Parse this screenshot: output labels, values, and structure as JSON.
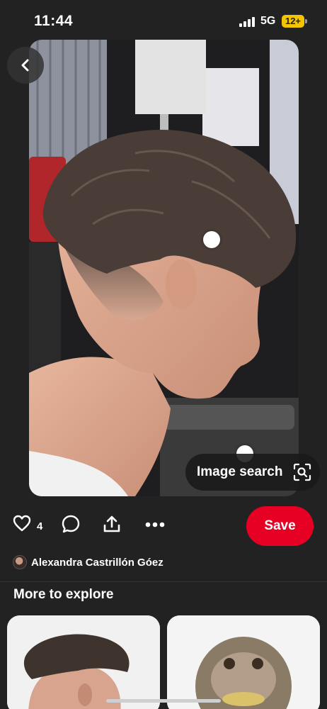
{
  "status_bar": {
    "time": "11:44",
    "network": "5G",
    "battery": "12+"
  },
  "pin": {
    "image_description_icon": "photo-of-haircut",
    "image_search_label": "Image search",
    "like_count": "4",
    "save_label": "Save",
    "author_name": "Alexandra Castrillón Góez"
  },
  "more_to_explore": {
    "title": "More to explore"
  },
  "colors": {
    "background": "#222222",
    "save_button": "#e60023",
    "battery": "#f5c400"
  }
}
